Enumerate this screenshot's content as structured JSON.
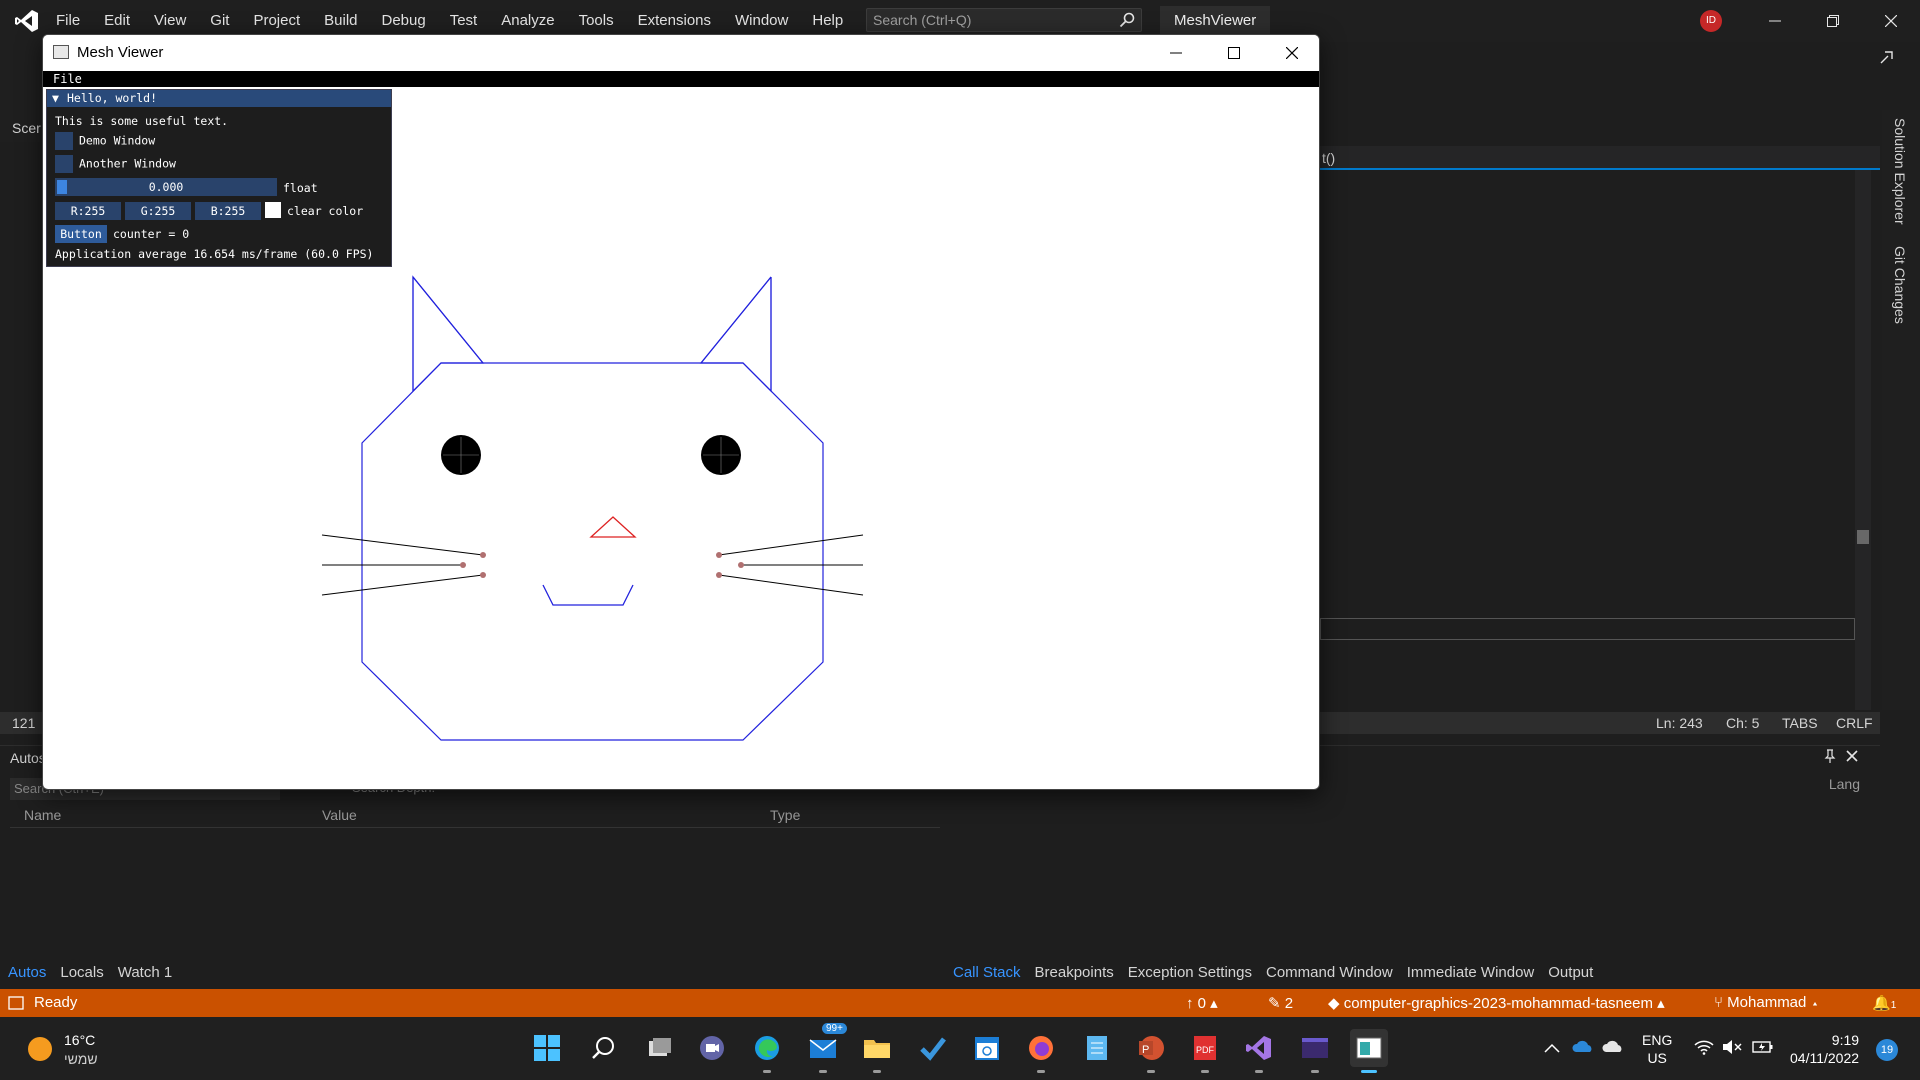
{
  "vs": {
    "menu": [
      "File",
      "Edit",
      "View",
      "Git",
      "Project",
      "Build",
      "Debug",
      "Test",
      "Analyze",
      "Tools",
      "Extensions",
      "Window",
      "Help"
    ],
    "search_placeholder": "Search (Ctrl+Q)",
    "solution_name": "MeshViewer",
    "user_initials": "ID",
    "editor_tab_label": "Scer",
    "editor_member": "t()",
    "right_rail_tabs": [
      "Solution Explorer",
      "Git Changes"
    ],
    "editor_status": {
      "line_number": "121",
      "ln": "Ln: 243",
      "ch": "Ch: 5",
      "tabs": "TABS",
      "eol": "CRLF"
    },
    "autos": {
      "title": "Autos",
      "search_placeholder": "Search (Ctrl+E)",
      "search_depth_label": "Search Depth:",
      "columns": [
        "Name",
        "Value",
        "Type"
      ],
      "tabs": [
        "Autos",
        "Locals",
        "Watch 1"
      ],
      "active_tab": "Autos"
    },
    "callstack": {
      "column": "Lang",
      "tabs": [
        "Call Stack",
        "Breakpoints",
        "Exception Settings",
        "Command Window",
        "Immediate Window",
        "Output"
      ],
      "active_tab": "Call Stack"
    },
    "statusbar": {
      "ready": "Ready",
      "push_count": "0",
      "pending_changes": "2",
      "repo": "computer-graphics-2023-mohammad-tasneem",
      "branch": "Mohammad",
      "notifications": "1"
    },
    "accent_color": "#ca5100"
  },
  "mesh_window": {
    "title": "Mesh Viewer",
    "menu_file": "File"
  },
  "imgui": {
    "title": "Hello, world!",
    "text": "This is some useful text.",
    "checkbox_demo": "Demo Window",
    "checkbox_another": "Another Window",
    "slider_value": "0.000",
    "slider_label": "float",
    "slider_fraction": 0.0,
    "color_r": "R:255",
    "color_g": "G:255",
    "color_b": "B:255",
    "color_label": "clear color",
    "button_label": "Button",
    "counter_text": "counter = 0",
    "fps_text": "Application average 16.654 ms/frame (60.0 FPS)"
  },
  "taskbar": {
    "weather_temp": "16°C",
    "weather_day": "שמשי",
    "mail_badge": "99+",
    "lang_line1": "ENG",
    "lang_line2": "US",
    "time": "9:19",
    "date": "04/11/2022",
    "notification_count": "19"
  }
}
